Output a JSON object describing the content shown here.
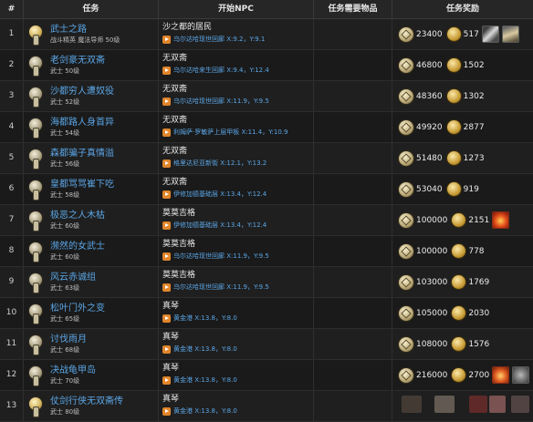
{
  "headers": {
    "num": "#",
    "quest": "任务",
    "npc": "开始NPC",
    "items": "任务需要物品",
    "rewards": "任务奖励"
  },
  "rows": [
    {
      "num": "1",
      "name": "武士之路",
      "sub": "战斗精英 魔法导师 50级",
      "npc": "沙之都的居民",
      "loc": "乌尔达哈现世回廊 X:9.2，Y:9.1",
      "xp": "23400",
      "gil": "517",
      "items": [
        "sword",
        "scroll"
      ],
      "gold": true
    },
    {
      "num": "2",
      "name": "老剑豪无双斋",
      "sub": "武士 50级",
      "npc": "无双斋",
      "loc": "乌尔达哈来生回廊 X:9.4，Y:12.4",
      "xp": "46800",
      "gil": "1502",
      "items": []
    },
    {
      "num": "3",
      "name": "沙都穷人遭奴役",
      "sub": "武士 52级",
      "npc": "无双斋",
      "loc": "乌尔达哈现世回廊 X:11.9，Y:9.5",
      "xp": "48360",
      "gil": "1302",
      "items": []
    },
    {
      "num": "4",
      "name": "海都路人身首异",
      "sub": "武士 54级",
      "npc": "无双斋",
      "loc": "利姆萨·罗敏萨上层甲板 X:11.4，Y:10.9",
      "xp": "49920",
      "gil": "2877",
      "items": []
    },
    {
      "num": "5",
      "name": "森都骗子真情溢",
      "sub": "武士 56级",
      "npc": "无双斋",
      "loc": "格里达尼亚新街 X:12.1，Y:13.2",
      "xp": "51480",
      "gil": "1273",
      "items": []
    },
    {
      "num": "6",
      "name": "皇都骂骂崔下吃",
      "sub": "武士 58级",
      "npc": "无双斋",
      "loc": "伊修加德基础层 X:13.4，Y:12.4",
      "xp": "53040",
      "gil": "919",
      "items": []
    },
    {
      "num": "7",
      "name": "极恶之人木枯",
      "sub": "武士 60级",
      "npc": "莫莫吉格",
      "loc": "伊修加德基础层 X:13.4，Y:12.4",
      "xp": "100000",
      "gil": "2151",
      "items": [
        "fire"
      ]
    },
    {
      "num": "8",
      "name": "濒然的女武士",
      "sub": "武士 60级",
      "npc": "莫莫吉格",
      "loc": "乌尔达哈现世回廊 X:11.9，Y:9.5",
      "xp": "100000",
      "gil": "778",
      "items": []
    },
    {
      "num": "9",
      "name": "风云赤诚组",
      "sub": "武士 63级",
      "npc": "莫莫吉格",
      "loc": "乌尔达哈现世回廊 X:11.9，Y:9.5",
      "xp": "103000",
      "gil": "1769",
      "items": []
    },
    {
      "num": "10",
      "name": "松叶门外之变",
      "sub": "武士 65级",
      "npc": "真琴",
      "loc": "黄金港 X:13.8，Y:8.0",
      "xp": "105000",
      "gil": "2030",
      "items": []
    },
    {
      "num": "11",
      "name": "讨伐雨月",
      "sub": "武士 68级",
      "npc": "真琴",
      "loc": "黄金港 X:13.8，Y:8.0",
      "xp": "108000",
      "gil": "1576",
      "items": []
    },
    {
      "num": "12",
      "name": "决战龟甲岛",
      "sub": "武士 70级",
      "npc": "真琴",
      "loc": "黄金港 X:13.8，Y:8.0",
      "xp": "216000",
      "gil": "2700",
      "items": [
        "fire2",
        "bird"
      ]
    },
    {
      "num": "13",
      "name": "仗剑行侠无双斋传",
      "sub": "武士 80级",
      "npc": "真琴",
      "loc": "黄金港 X:13.8，Y:8.0",
      "xp": "",
      "gil": "",
      "items": [],
      "gold": true
    }
  ],
  "colors": {
    "link": "#5ba6e6",
    "header_bg": "#262626",
    "bg": "#1b1b1b"
  }
}
